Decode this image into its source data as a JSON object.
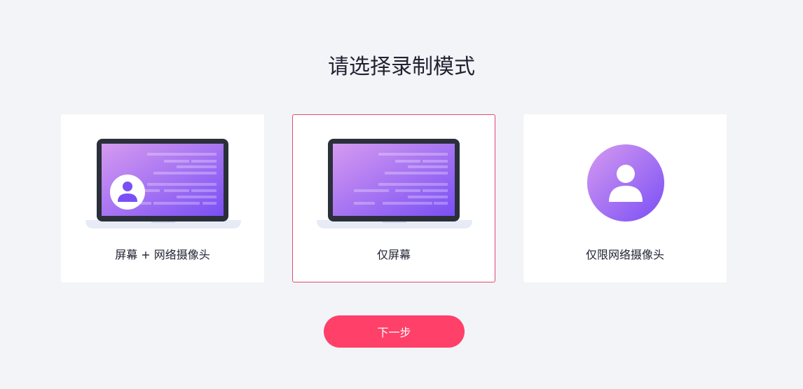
{
  "title": "请选择录制模式",
  "options": [
    {
      "label": "屏幕 + 网络摄像头",
      "icon": "laptop-with-webcam-icon",
      "selected": false
    },
    {
      "label": "仅屏幕",
      "icon": "laptop-screen-icon",
      "selected": true
    },
    {
      "label": "仅限网络摄像头",
      "icon": "webcam-user-icon",
      "selected": false
    }
  ],
  "next_button": {
    "label": "下一步"
  },
  "colors": {
    "background": "#f3f4f8",
    "accent": "#ff4069",
    "selected_border": "#e14a6c",
    "gradient_start": "#d59af0",
    "gradient_end": "#7a4ff5",
    "laptop_frame": "#2b2f3a",
    "laptop_base": "#e6ebf5"
  }
}
